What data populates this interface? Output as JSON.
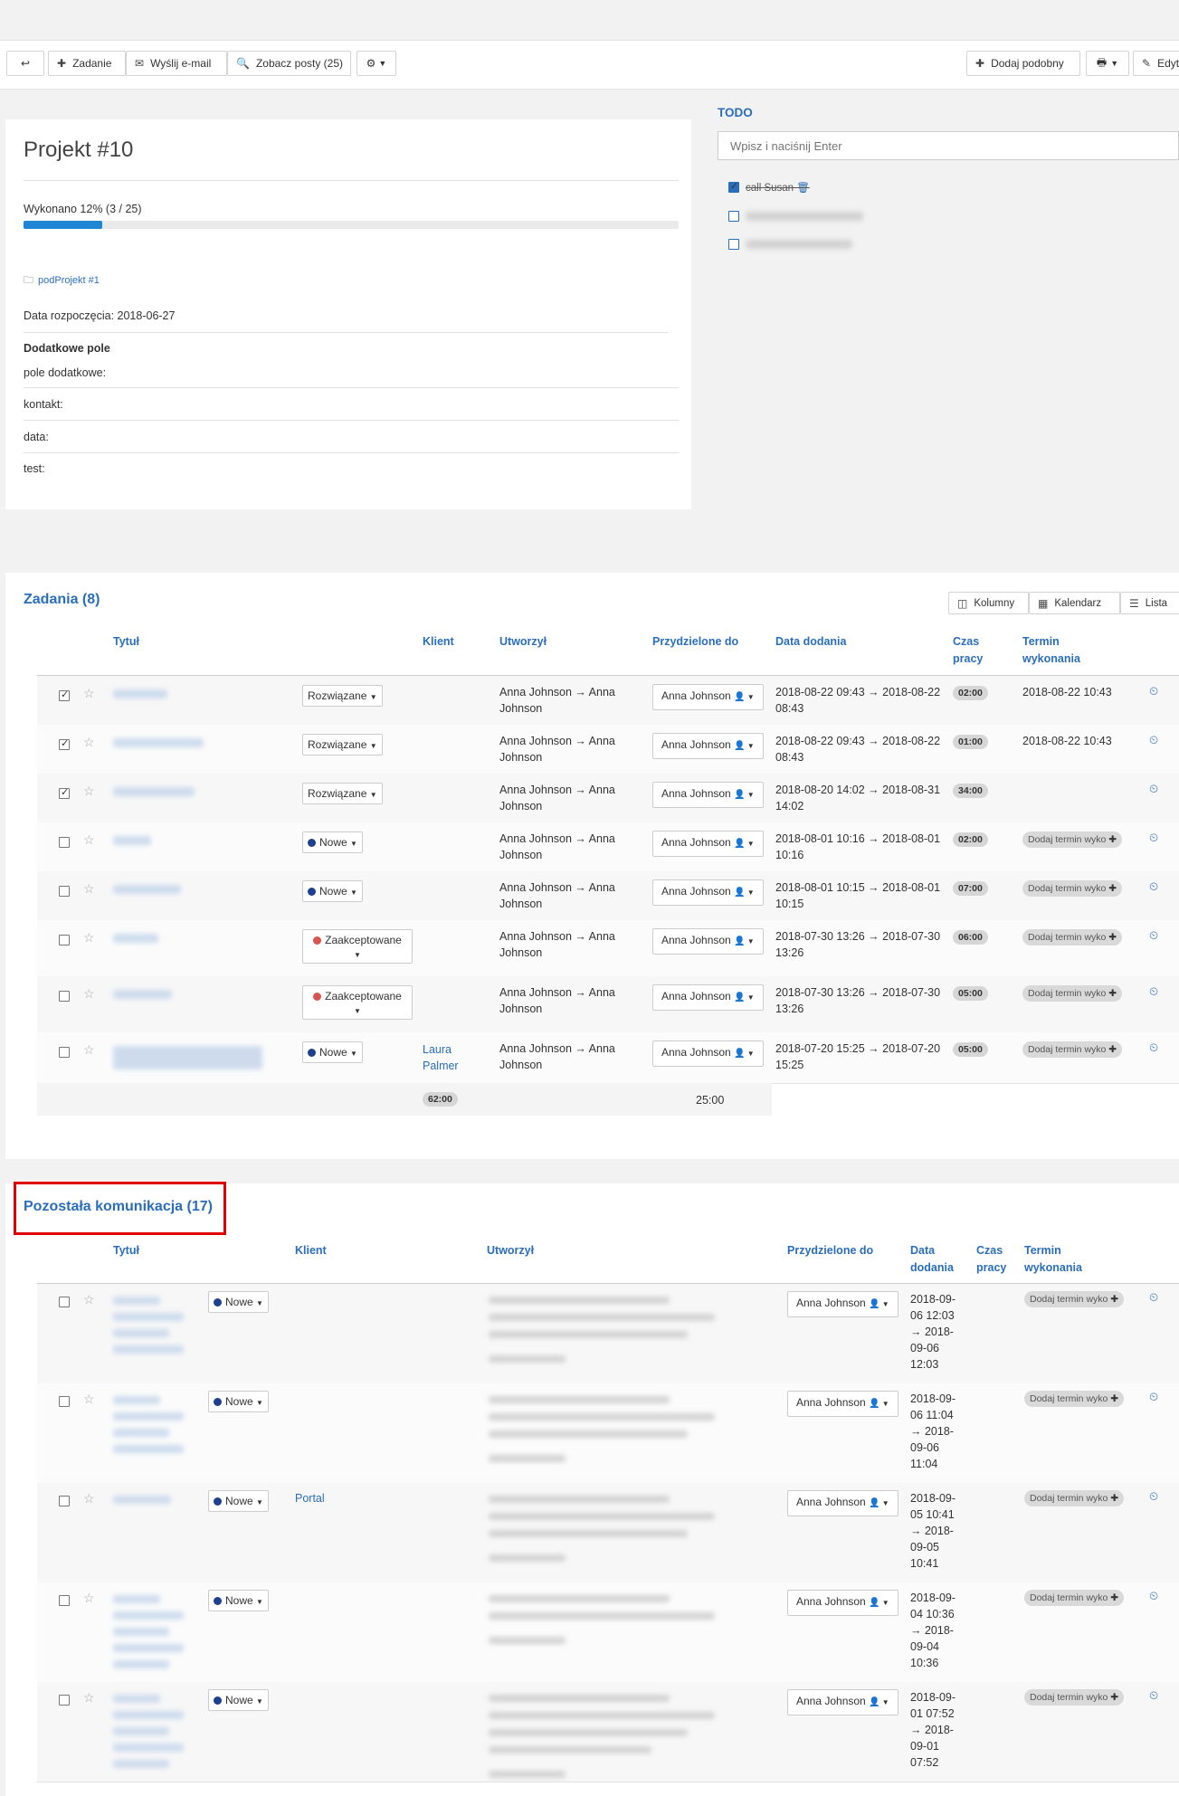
{
  "toolbar": {
    "back_icon": "↩",
    "task_label": "Zadanie",
    "email_label": "Wyślij e-mail",
    "posts_label": "Zobacz posty (25)",
    "settings_icon": "⚙",
    "add_similar_label": "Dodaj podobny",
    "print_icon": "🖶",
    "edit_label": "Edyt"
  },
  "project": {
    "title": "Projekt #10",
    "progress_text": "Wykonano 12% (3 / 25)",
    "progress_fraction": 0.12,
    "subproject": "podProjekt #1",
    "start_date": "Data rozpoczęcia: 2018-06-27",
    "extra_heading": "Dodatkowe pole",
    "fields": [
      "pole dodatkowe:",
      "kontakt:",
      "data:",
      "test:"
    ]
  },
  "todo": {
    "heading": "TODO",
    "placeholder": "Wpisz i naciśnij Enter",
    "done_item": "call Susan"
  },
  "tasks": {
    "heading": "Zadania (8)",
    "view_buttons": [
      "Kolumny",
      "Kalendarz",
      "Lista"
    ],
    "columns": {
      "title": "Tytuł",
      "client": "Klient",
      "created": "Utworzył",
      "assigned": "Przydzielone do",
      "date_added": "Data dodania",
      "time_1": "Czas",
      "time_2": "pracy",
      "due_1": "Termin",
      "due_2": "wykonania"
    },
    "rows": [
      {
        "checked": true,
        "status": "Rozwiązane",
        "client": "",
        "created": "Anna Johnson → Anna Johnson",
        "assigned": "Anna Johnson",
        "date": "2018-08-22 09:43 → 2018-08-22 08:43",
        "time": "02:00",
        "due": "2018-08-22 10:43"
      },
      {
        "checked": true,
        "status": "Rozwiązane",
        "client": "",
        "created": "Anna Johnson → Anna Johnson",
        "assigned": "Anna Johnson",
        "date": "2018-08-22 09:43 → 2018-08-22 08:43",
        "time": "01:00",
        "due": "2018-08-22 10:43"
      },
      {
        "checked": true,
        "status": "Rozwiązane",
        "client": "",
        "created": "Anna Johnson → Anna Johnson",
        "assigned": "Anna Johnson",
        "date": "2018-08-20 14:02 → 2018-08-31 14:02",
        "time": "34:00",
        "due": ""
      },
      {
        "checked": false,
        "status": "Nowe",
        "client": "",
        "created": "Anna Johnson → Anna Johnson",
        "assigned": "Anna Johnson",
        "date": "2018-08-01 10:16 → 2018-08-01 10:16",
        "time": "02:00",
        "due": "Dodaj termin wyko"
      },
      {
        "checked": false,
        "status": "Nowe",
        "client": "",
        "created": "Anna Johnson → Anna Johnson",
        "assigned": "Anna Johnson",
        "date": "2018-08-01 10:15 → 2018-08-01 10:15",
        "time": "07:00",
        "due": "Dodaj termin wyko"
      },
      {
        "checked": false,
        "status": "Zaakceptowane",
        "client": "",
        "created": "Anna Johnson → Anna Johnson",
        "assigned": "Anna Johnson",
        "date": "2018-07-30 13:26 → 2018-07-30 13:26",
        "time": "06:00",
        "due": "Dodaj termin wyko"
      },
      {
        "checked": false,
        "status": "Zaakceptowane",
        "client": "",
        "created": "Anna Johnson → Anna Johnson",
        "assigned": "Anna Johnson",
        "date": "2018-07-30 13:26 → 2018-07-30 13:26",
        "time": "05:00",
        "due": "Dodaj termin wyko"
      },
      {
        "checked": false,
        "status": "Nowe",
        "client": "Laura Palmer",
        "created": "Anna Johnson → Anna Johnson",
        "assigned": "Anna Johnson",
        "date": "2018-07-20 15:25 → 2018-07-20 15:25",
        "time": "05:00",
        "due": "Dodaj termin wyko"
      }
    ],
    "total_badge": "62:00",
    "total_text": "25:00"
  },
  "comms": {
    "heading": "Pozostała komunikacja (17)",
    "columns": {
      "title": "Tytuł",
      "client": "Klient",
      "created": "Utworzył",
      "assigned": "Przydzielone do",
      "date_1": "Data",
      "date_2": "dodania",
      "time_1": "Czas",
      "time_2": "pracy",
      "due_1": "Termin",
      "due_2": "wykonania"
    },
    "rows": [
      {
        "status": "Nowe",
        "client": "",
        "assigned": "Anna Johnson",
        "date": [
          "2018-09-",
          "06 12:03",
          "→ 2018-",
          "09-06",
          "12:03"
        ],
        "due": "Dodaj termin wyko"
      },
      {
        "status": "Nowe",
        "client": "",
        "assigned": "Anna Johnson",
        "date": [
          "2018-09-",
          "06 11:04",
          "→ 2018-",
          "09-06",
          "11:04"
        ],
        "due": "Dodaj termin wyko"
      },
      {
        "status": "Nowe",
        "client": "Portal",
        "assigned": "Anna Johnson",
        "date": [
          "2018-09-",
          "05 10:41",
          "→ 2018-",
          "09-05",
          "10:41"
        ],
        "due": "Dodaj termin wyko"
      },
      {
        "status": "Nowe",
        "client": "",
        "assigned": "Anna Johnson",
        "date": [
          "2018-09-",
          "04 10:36",
          "→ 2018-",
          "09-04",
          "10:36"
        ],
        "due": "Dodaj termin wyko"
      },
      {
        "status": "Nowe",
        "client": "",
        "assigned": "Anna Johnson",
        "date": [
          "2018-09-",
          "01 07:52",
          "→ 2018-",
          "09-01",
          "07:52"
        ],
        "due": "Dodaj termin wyko"
      }
    ]
  },
  "colors": {
    "accent": "#2a6ebb",
    "progress": "#1f86d6",
    "status_new": "#1f3f8f",
    "status_accepted": "#d9534f",
    "highlight_box": "#e00000"
  }
}
